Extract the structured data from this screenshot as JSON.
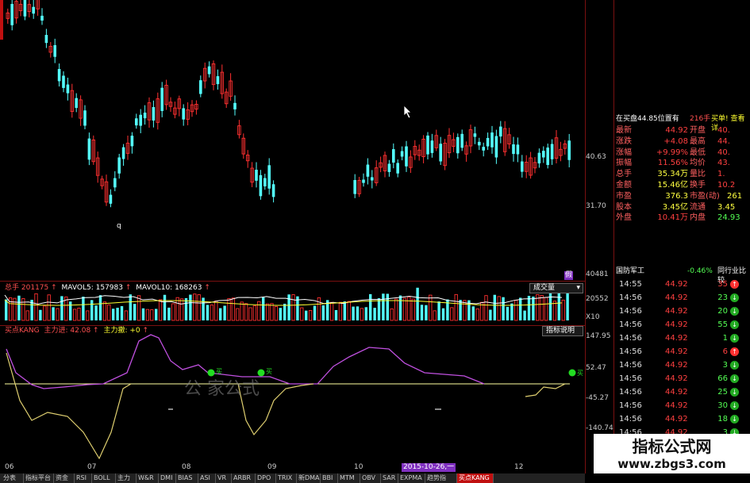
{
  "price_panel": {
    "y_ticks": [
      "40.63",
      "31.70"
    ],
    "low_mark": "q",
    "corner_mark": "假"
  },
  "volume_panel": {
    "label_vol": "总手",
    "vol_value": "201175",
    "label_ma5": "MAVOL5:",
    "ma5_value": "157983",
    "label_ma10": "MAVOL10:",
    "ma10_value": "168263",
    "button": "成交量",
    "y_ticks": [
      "40481",
      "20552",
      "X10"
    ]
  },
  "indicator_panel": {
    "name": "买点KANG",
    "label_main": "主力进:",
    "main_value": "42.08",
    "label_mainbuy": "主力撤:",
    "mainbuy_value": "+0",
    "button": "指标说明",
    "y_ticks": [
      "147.95",
      "52.47",
      "-45.27",
      "-140.74"
    ],
    "markers": [
      "买",
      "买",
      "买"
    ],
    "watermark": "公 家公式"
  },
  "x_axis": {
    "labels": [
      "06",
      "07",
      "08",
      "09",
      "10",
      "2015-10-26,一",
      "12"
    ]
  },
  "tabs": [
    "分表",
    "指标平台",
    "资金",
    "RSI",
    "BOLL",
    "主力",
    "W&R",
    "DMI",
    "BIAS",
    "ASI",
    "VR",
    "ARBR",
    "DPO",
    "TRIX",
    "新DMA",
    "BBI",
    "MTM",
    "OBV",
    "SAR",
    "EXPMA",
    "趋势指",
    "买点KANG"
  ],
  "quote": {
    "header_left": "在买盘44.85位置有",
    "header_mid": "216手",
    "header_right": "买单! 查看详",
    "rows": [
      {
        "l1": "最新",
        "v1": "44.92",
        "l2": "开盘",
        "v2": "40."
      },
      {
        "l1": "涨跌",
        "v1": "+4.08",
        "l2": "最高",
        "v2": "44."
      },
      {
        "l1": "涨幅",
        "v1": "+9.99%",
        "l2": "最低",
        "v2": "40."
      },
      {
        "l1": "振幅",
        "v1": "11.56%",
        "l2": "均价",
        "v2": "43."
      },
      {
        "l1": "总手",
        "v1": "35.34万",
        "l2": "量比",
        "v2": "1."
      },
      {
        "l1": "金额",
        "v1": "15.46亿",
        "l2": "换手",
        "v2": "10.2"
      },
      {
        "l1": "市盈",
        "v1": "376.3",
        "l2": "市盈(动)",
        "v2": "261"
      },
      {
        "l1": "股本",
        "v1": "3.45亿",
        "l2": "流通",
        "v2": "3.45"
      },
      {
        "l1": "外盘",
        "v1": "10.41万",
        "l2": "内盘",
        "v2": "24.93"
      }
    ],
    "sector_name": "国防军工",
    "sector_change": "-0.46%",
    "sector_link": "同行业比较",
    "trades": [
      {
        "time": "14:55",
        "price": "44.92",
        "vol": "35",
        "dir": "up"
      },
      {
        "time": "14:56",
        "price": "44.92",
        "vol": "23",
        "dir": "down"
      },
      {
        "time": "14:56",
        "price": "44.92",
        "vol": "20",
        "dir": "down"
      },
      {
        "time": "14:56",
        "price": "44.92",
        "vol": "55",
        "dir": "down"
      },
      {
        "time": "14:56",
        "price": "44.92",
        "vol": "1",
        "dir": "down"
      },
      {
        "time": "14:56",
        "price": "44.92",
        "vol": "6",
        "dir": "up"
      },
      {
        "time": "14:56",
        "price": "44.92",
        "vol": "3",
        "dir": "down"
      },
      {
        "time": "14:56",
        "price": "44.92",
        "vol": "66",
        "dir": "down"
      },
      {
        "time": "14:56",
        "price": "44.92",
        "vol": "25",
        "dir": "down"
      },
      {
        "time": "14:56",
        "price": "44.92",
        "vol": "30",
        "dir": "down"
      },
      {
        "time": "14:56",
        "price": "44.92",
        "vol": "18",
        "dir": "down"
      },
      {
        "time": "14:56",
        "price": "44.92",
        "vol": "3",
        "dir": "down"
      }
    ]
  },
  "site_banner": {
    "title": "指标公式网",
    "url": "www.zbgs3.com"
  },
  "colors": {
    "up": "#ff3030",
    "down": "#54ffff",
    "frame": "#7a1010",
    "yellow": "#ffff30",
    "green_marker": "#22dd22"
  }
}
